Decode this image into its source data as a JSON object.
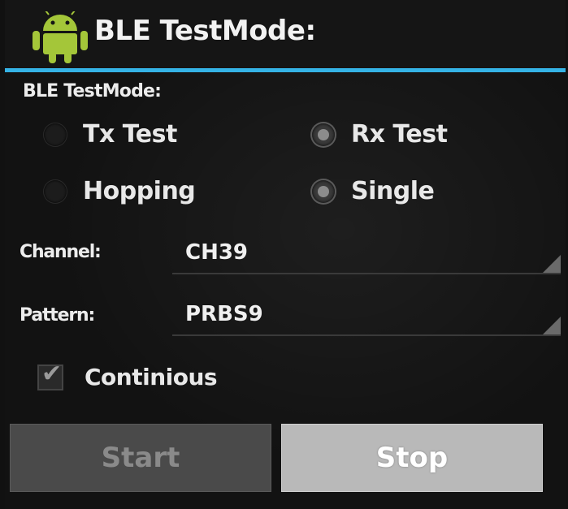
{
  "app": {
    "title": "BLE TestMode:",
    "icon": "android-icon"
  },
  "colors": {
    "accent": "#35b3e6",
    "background": "#121212",
    "icon_green": "#a4c639"
  },
  "section_label": "BLE TestMode:",
  "test_type": {
    "options": [
      {
        "label": "Tx Test",
        "checked": false
      },
      {
        "label": "Rx Test",
        "checked": true
      }
    ]
  },
  "frequency_mode": {
    "options": [
      {
        "label": "Hopping",
        "checked": false
      },
      {
        "label": "Single",
        "checked": true
      }
    ]
  },
  "channel": {
    "label": "Channel:",
    "value": "CH39"
  },
  "pattern": {
    "label": "Pattern:",
    "value": "PRBS9"
  },
  "continuous": {
    "label": "Continious",
    "checked": true
  },
  "buttons": {
    "start": {
      "label": "Start",
      "enabled": false
    },
    "stop": {
      "label": "Stop",
      "enabled": true
    }
  }
}
